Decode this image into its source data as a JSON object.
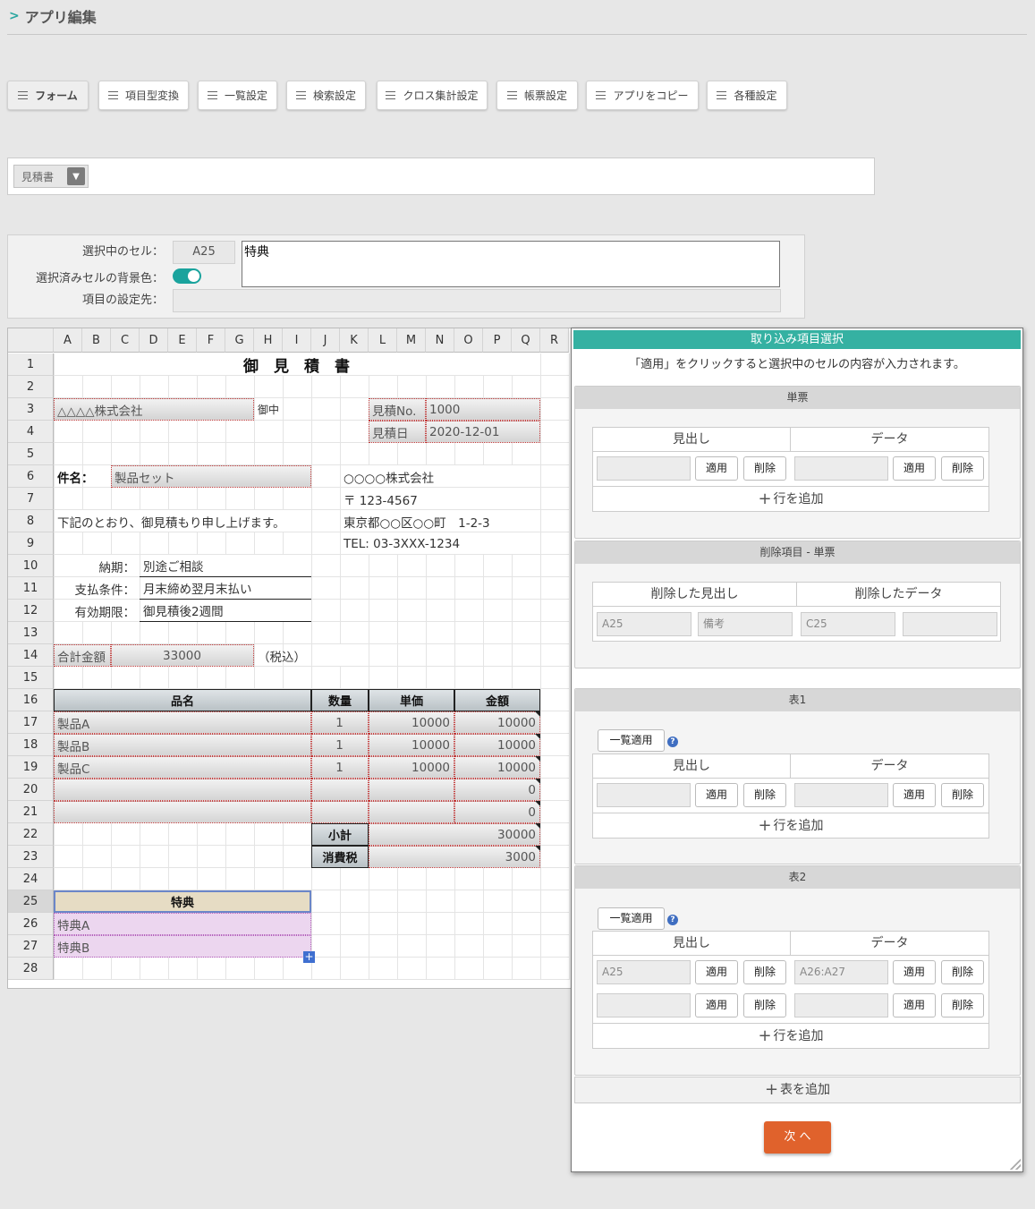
{
  "header": {
    "title": "アプリ編集"
  },
  "toolbar": [
    {
      "label": "フォーム",
      "active": true
    },
    {
      "label": "項目型変換"
    },
    {
      "label": "一覧設定"
    },
    {
      "label": "検索設定"
    },
    {
      "label": "クロス集計設定"
    },
    {
      "label": "帳票設定"
    },
    {
      "label": "アプリをコピー"
    },
    {
      "label": "各種設定"
    }
  ],
  "sheet_selector": {
    "value": "見積書"
  },
  "cell_panel": {
    "selected_label": "選択中のセル：",
    "selected_cell": "A25",
    "cell_value": "特典",
    "bg_label": "選択済みセルの背景色：",
    "bg_toggle_on": true,
    "target_label": "項目の設定先："
  },
  "spreadsheet": {
    "columns": [
      "A",
      "B",
      "C",
      "D",
      "E",
      "F",
      "G",
      "H",
      "I",
      "J",
      "K",
      "L",
      "M",
      "N",
      "O",
      "P",
      "Q",
      "R"
    ],
    "rows": [
      "1",
      "2",
      "3",
      "4",
      "5",
      "6",
      "7",
      "8",
      "9",
      "10",
      "11",
      "12",
      "13",
      "14",
      "15",
      "16",
      "17",
      "18",
      "19",
      "20",
      "21",
      "22",
      "23",
      "24",
      "25",
      "26",
      "27",
      "28"
    ],
    "title": "御　見　積　書",
    "customer": "△△△△株式会社",
    "honorific": "御中",
    "quote_no_label": "見積No.",
    "quote_no": "1000",
    "quote_date_label": "見積日",
    "quote_date": "2020-12-01",
    "subject_label": "件名：",
    "subject": "製品セット",
    "company": "○○○○株式会社",
    "postal": "〒 123-4567",
    "address": "東京都○○区○○町　1-2-3",
    "tel": "TEL: 03-3XXX-1234",
    "intro": "下記のとおり、御見積もり申し上げます。",
    "delivery_label": "納期：",
    "delivery": "別途ご相談",
    "payment_label": "支払条件：",
    "payment": "月末締め翌月末払い",
    "valid_label": "有効期限：",
    "valid": "御見積後2週間",
    "total_label": "合計金額",
    "total": "33000",
    "tax_note": "（税込）",
    "headers": {
      "name": "品名",
      "qty": "数量",
      "unit": "単価",
      "amount": "金額"
    },
    "items": [
      {
        "name": "製品A",
        "qty": "1",
        "unit": "10000",
        "amount": "10000"
      },
      {
        "name": "製品B",
        "qty": "1",
        "unit": "10000",
        "amount": "10000"
      },
      {
        "name": "製品C",
        "qty": "1",
        "unit": "10000",
        "amount": "10000"
      },
      {
        "name": "",
        "qty": "",
        "unit": "",
        "amount": "0"
      },
      {
        "name": "",
        "qty": "",
        "unit": "",
        "amount": "0"
      }
    ],
    "subtotal_label": "小計",
    "subtotal": "30000",
    "tax_label": "消費税",
    "tax": "3000",
    "bonus_header": "特典",
    "bonus_items": [
      "特典A",
      "特典B"
    ]
  },
  "dialog": {
    "title": "取り込み項目選択",
    "note": "「適用」をクリックすると選択中のセルの内容が入力されます。",
    "apply": "適用",
    "delete": "削除",
    "add_row": "行を追加",
    "list_apply": "一覧適用",
    "help": "?",
    "heading_col": "見出し",
    "data_col": "データ",
    "single": {
      "title": "単票",
      "rows": [
        {
          "heading": "",
          "data": ""
        }
      ]
    },
    "deleted": {
      "title": "削除項目 - 単票",
      "heading_col": "削除した見出し",
      "data_col": "削除したデータ",
      "values": [
        "A25",
        "備考",
        "C25",
        ""
      ]
    },
    "table1": {
      "title": "表1",
      "rows": [
        {
          "heading": "",
          "data": ""
        }
      ]
    },
    "table2": {
      "title": "表2",
      "rows": [
        {
          "heading": "A25",
          "data": "A26:A27"
        },
        {
          "heading": "",
          "data": ""
        }
      ]
    },
    "add_table": "表を追加",
    "next": "次 へ"
  }
}
